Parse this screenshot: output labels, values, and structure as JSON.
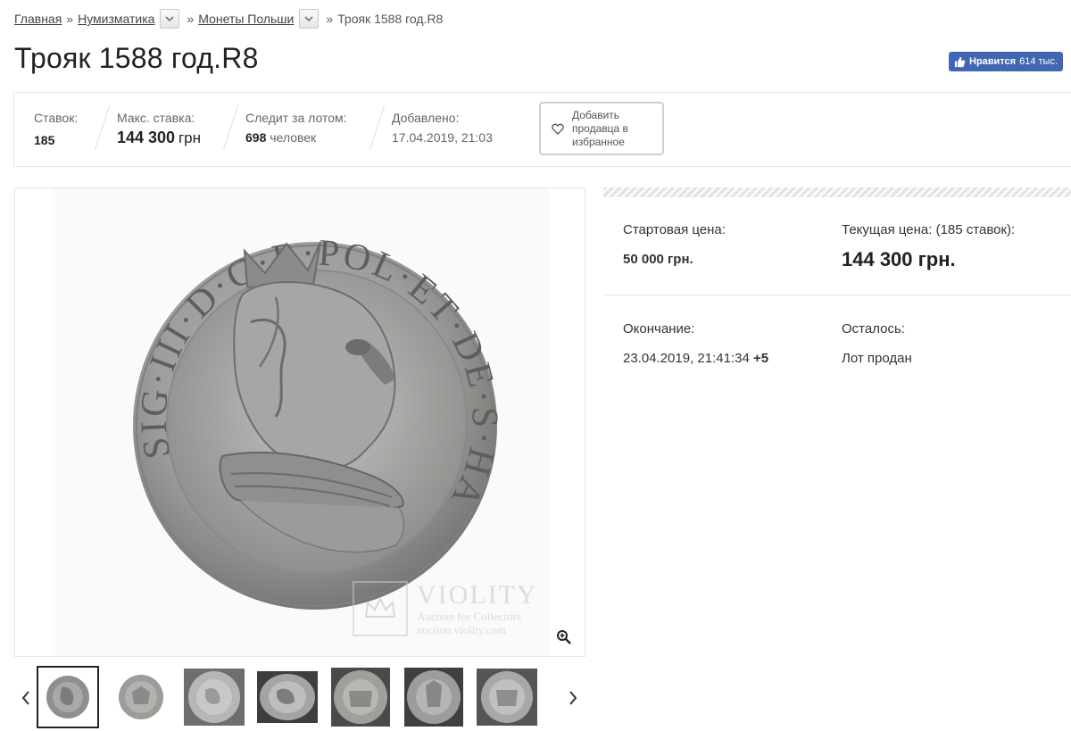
{
  "breadcrumb": {
    "home": "Главная",
    "sep": "»",
    "numismatics": "Нумизматика",
    "poland_coins": "Монеты Польши",
    "current": "Трояк 1588 год.R8"
  },
  "page_title": "Трояк 1588 год.R8",
  "fb_like": {
    "label": "Нравится",
    "count": "614 тыс."
  },
  "stats": {
    "bids_label": "Ставок:",
    "bids_value": "185",
    "max_bid_label": "Макс. ставка:",
    "max_bid_value": "144 300",
    "max_bid_currency": "грн",
    "watchers_label": "Следит за лотом:",
    "watchers_value": "698",
    "watchers_unit": "человек",
    "added_label": "Добавлено:",
    "added_value": "17.04.2019, 21:03",
    "fav_button": "Добавить продавца в избранное"
  },
  "watermark": {
    "brand": "VIOLITY",
    "line1": "Auction for Collectors",
    "line2": "auction.violity.com"
  },
  "coin_legend": "SIG·III·D·G·R·POL·ET·DE·S·HAE·",
  "price": {
    "start_label": "Стартовая цена:",
    "start_value": "50 000 грн.",
    "current_label": "Текущая цена: (185 ставок):",
    "current_value": "144 300 грн."
  },
  "ending": {
    "end_label": "Окончание:",
    "end_value": "23.04.2019, 21:41:34",
    "end_tz": "+5",
    "left_label": "Осталось:",
    "left_value": "Лот продан"
  },
  "colors": {
    "accent_fb": "#4267b2",
    "text_dark": "#222222",
    "border": "#e6e6e6"
  },
  "icons": [
    "chevron-down-icon",
    "thumbs-up-icon",
    "heart-icon",
    "zoom-in-icon",
    "chevron-left-icon",
    "chevron-right-icon"
  ]
}
